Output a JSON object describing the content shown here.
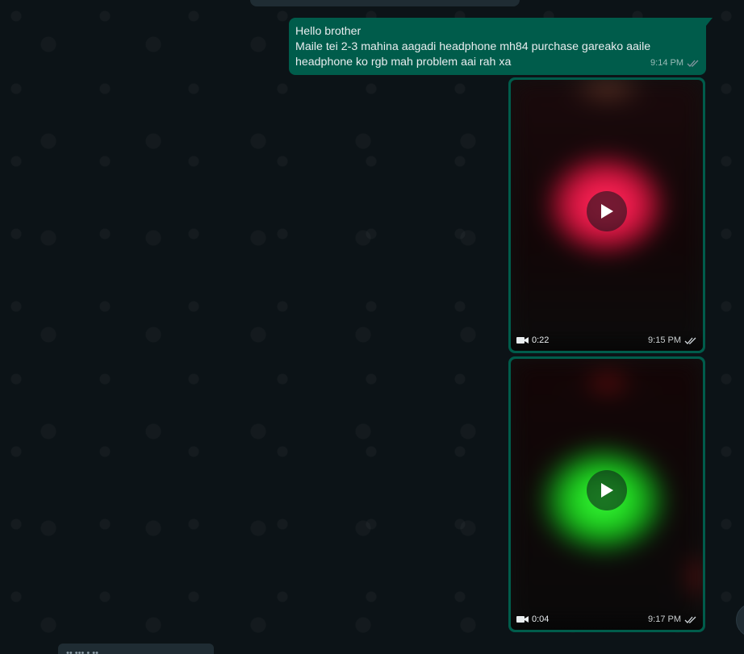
{
  "chat": {
    "messages": [
      {
        "type": "text",
        "lines": [
          "Hello brother",
          "Maile tei 2-3 mahina aagadi headphone mh84 purchase gareako aaile",
          "headphone ko rgb mah problem aai rah xa"
        ],
        "time": "9:14 PM",
        "status_icon": "double-check-icon"
      },
      {
        "type": "video",
        "duration": "0:22",
        "time": "9:15 PM",
        "status_icon": "double-check-icon",
        "dominant_color": "#e8184a"
      },
      {
        "type": "video",
        "duration": "0:04",
        "time": "9:17 PM",
        "status_icon": "double-check-icon",
        "dominant_color": "#1ed21e"
      }
    ],
    "bottom_preview": "••  ••• •  ••"
  },
  "colors": {
    "outgoing_bubble": "#005c4b",
    "background": "#0c1317",
    "text": "#e9edef"
  }
}
